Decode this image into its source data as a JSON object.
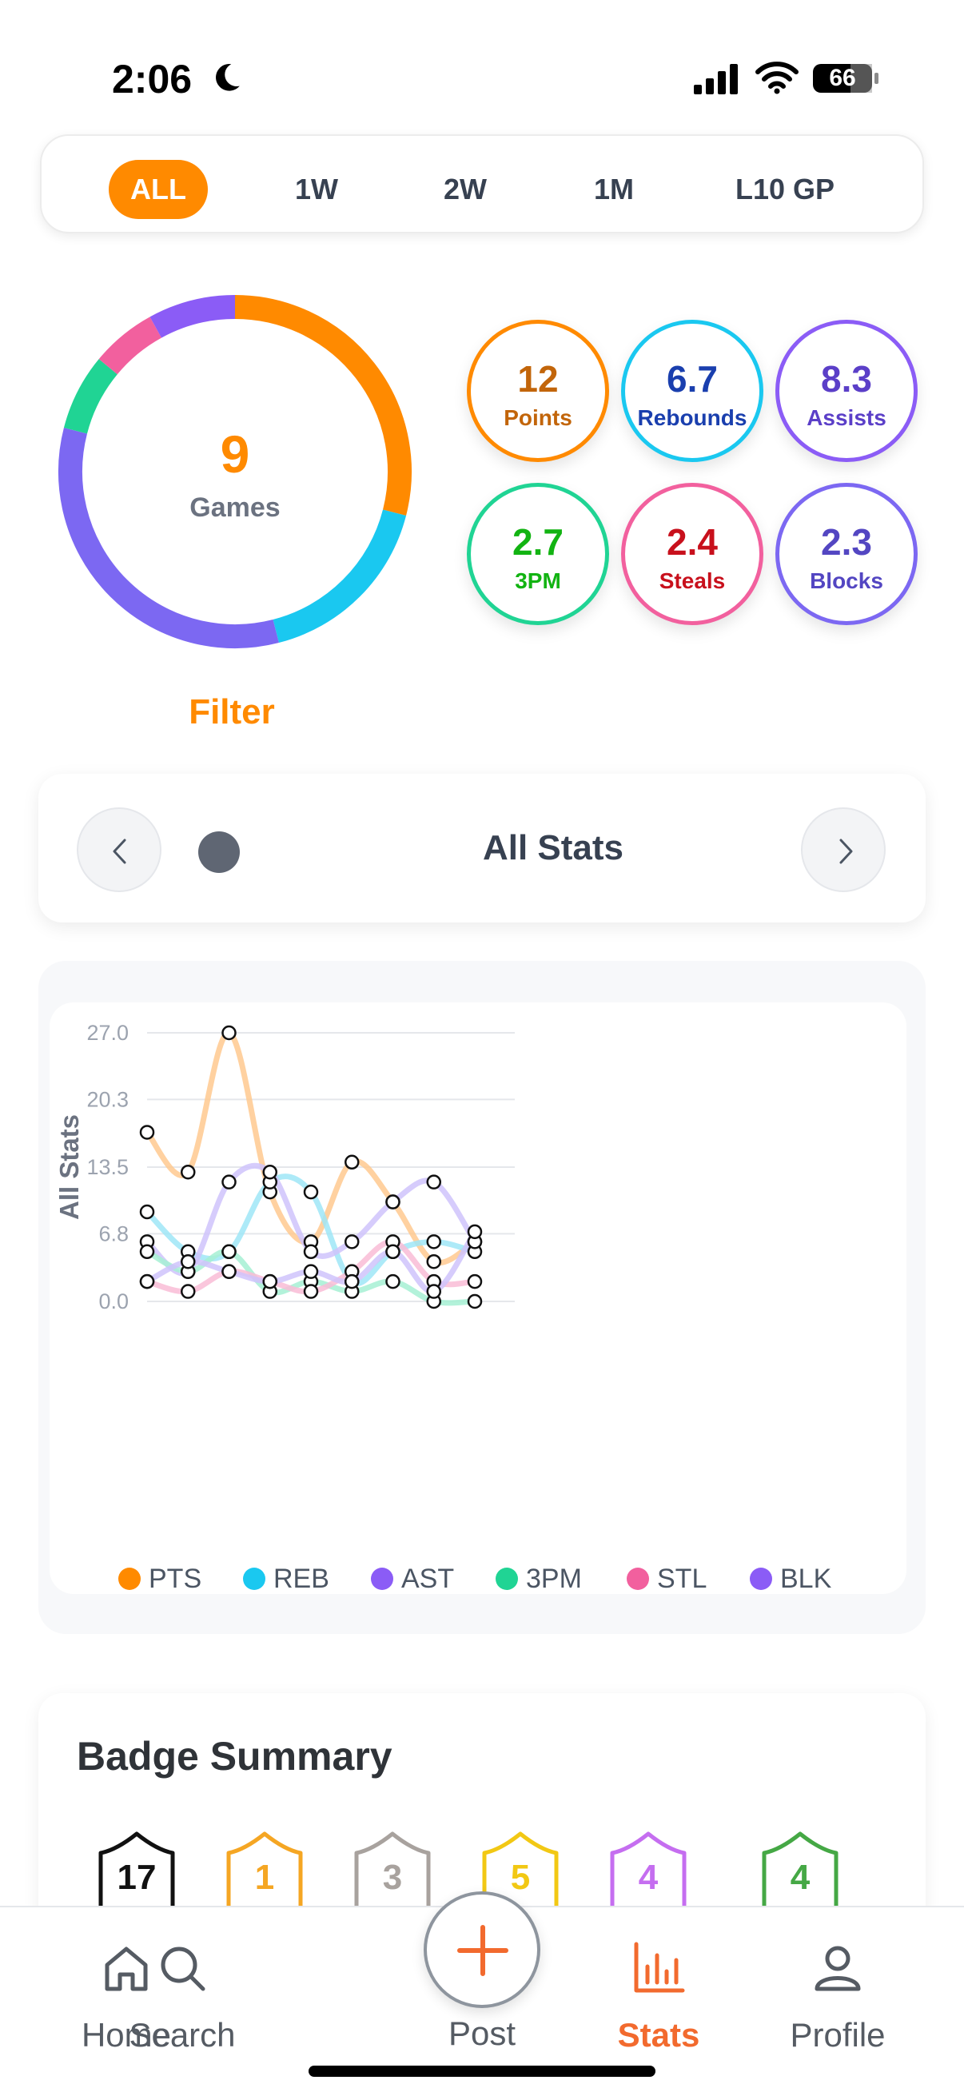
{
  "status_bar": {
    "time": "2:06",
    "battery": "66"
  },
  "range_filter": {
    "options": [
      "ALL",
      "1W",
      "2W",
      "1M",
      "L10 GP"
    ],
    "selected": "ALL"
  },
  "summary": {
    "games_count": "9",
    "games_label": "Games",
    "filter_label": "Filter",
    "stats": [
      {
        "value": "12",
        "label": "Points",
        "color": "#ff8a00",
        "text_color": "#c2650a"
      },
      {
        "value": "6.7",
        "label": "Rebounds",
        "color": "#1ac8f0",
        "text_color": "#1a3fae"
      },
      {
        "value": "8.3",
        "label": "Assists",
        "color": "#8b5cf6",
        "text_color": "#5b3fc8"
      },
      {
        "value": "2.7",
        "label": "3PM",
        "color": "#20d494",
        "text_color": "#12b312"
      },
      {
        "value": "2.4",
        "label": "Steals",
        "color": "#f2609e",
        "text_color": "#c8101c"
      },
      {
        "value": "2.3",
        "label": "Blocks",
        "color": "#7c68f2",
        "text_color": "#5346c2"
      }
    ],
    "donut_segments": [
      {
        "name": "PTS",
        "fraction": 0.29,
        "color": "#ff8a00"
      },
      {
        "name": "REB",
        "fraction": 0.17,
        "color": "#1ac8f0"
      },
      {
        "name": "AST",
        "fraction": 0.33,
        "color": "#7c68f2"
      },
      {
        "name": "3PM",
        "fraction": 0.07,
        "color": "#20d494"
      },
      {
        "name": "STL",
        "fraction": 0.06,
        "color": "#f2609e"
      },
      {
        "name": "BLK",
        "fraction": 0.08,
        "color": "#8b5cf6"
      }
    ]
  },
  "stat_selector": {
    "title": "All Stats",
    "dot_color": "#5f6673"
  },
  "chart_data": {
    "type": "line",
    "ylabel": "All Stats",
    "ylim": [
      0,
      27
    ],
    "y_ticks": [
      "27.0",
      "20.3",
      "13.5",
      "6.8",
      "0.0"
    ],
    "y_tick_values": [
      27,
      20.3,
      13.5,
      6.8,
      0
    ],
    "x": [
      1,
      2,
      3,
      4,
      5,
      6,
      7,
      8,
      9
    ],
    "grid": true,
    "legend_position": "bottom",
    "series": [
      {
        "name": "PTS",
        "color": "#ffc98f",
        "legend_color": "#ff8a00",
        "values": [
          17,
          13,
          27,
          11,
          6,
          14,
          10,
          4,
          6
        ]
      },
      {
        "name": "REB",
        "color": "#9fe6f7",
        "legend_color": "#1ac8f0",
        "values": [
          9,
          5,
          5,
          12,
          11,
          2,
          5,
          6,
          5
        ]
      },
      {
        "name": "AST",
        "color": "#cfc3fb",
        "legend_color": "#8b5cf6",
        "values": [
          6,
          3,
          12,
          13,
          5,
          6,
          10,
          12,
          6
        ]
      },
      {
        "name": "3PM",
        "color": "#a6f0d3",
        "legend_color": "#20d494",
        "values": [
          5,
          3,
          5,
          1,
          2,
          1,
          2,
          0,
          0
        ]
      },
      {
        "name": "STL",
        "color": "#f9bcd6",
        "legend_color": "#f2609e",
        "values": [
          2,
          1,
          3,
          2,
          1,
          3,
          6,
          2,
          2
        ]
      },
      {
        "name": "BLK",
        "color": "#cfc3fb",
        "legend_color": "#8b5cf6",
        "values": [
          2,
          4,
          3,
          2,
          3,
          2,
          5,
          1,
          7
        ]
      }
    ]
  },
  "badge_summary": {
    "title": "Badge Summary",
    "badges": [
      {
        "count": "17",
        "color": "#111111"
      },
      {
        "count": "1",
        "color": "#f5a623"
      },
      {
        "count": "3",
        "color": "#a8a29e"
      },
      {
        "count": "5",
        "color": "#f2c814"
      },
      {
        "count": "4",
        "color": "#c56ef0"
      },
      {
        "count": "4",
        "color": "#45a845"
      }
    ]
  },
  "tab_bar": {
    "tabs": [
      {
        "label": "Home"
      },
      {
        "label": "Search"
      },
      {
        "label": "Stats"
      },
      {
        "label": "Profile"
      }
    ],
    "post_label": "Post",
    "active": "Stats"
  }
}
